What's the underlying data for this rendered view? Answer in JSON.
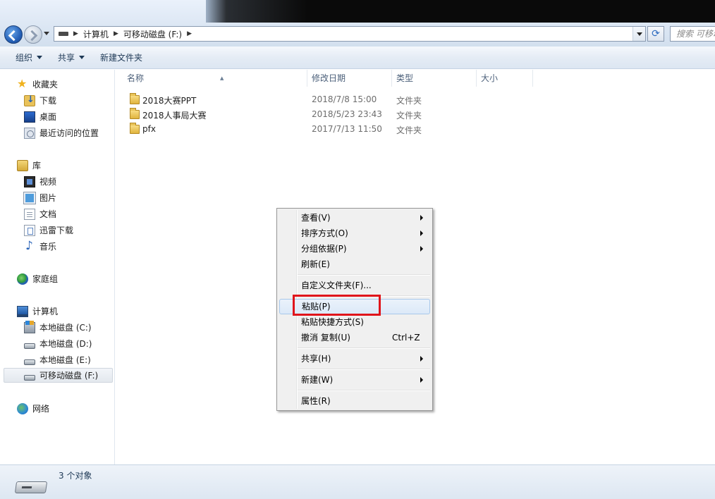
{
  "address": {
    "crumbs": [
      "计算机",
      "可移动磁盘 (F:)"
    ],
    "search_placeholder": "搜索 可移动"
  },
  "toolbar": {
    "organize": "组织",
    "share": "共享",
    "new_folder": "新建文件夹"
  },
  "sidebar": {
    "favorites": "收藏夹",
    "downloads": "下载",
    "desktop": "桌面",
    "recent": "最近访问的位置",
    "libraries": "库",
    "videos": "视频",
    "pictures": "图片",
    "documents": "文档",
    "thunder": "迅雷下载",
    "music": "音乐",
    "homegroup": "家庭组",
    "computer": "计算机",
    "drive_c": "本地磁盘 (C:)",
    "drive_d": "本地磁盘 (D:)",
    "drive_e": "本地磁盘 (E:)",
    "drive_f": "可移动磁盘 (F:)",
    "network": "网络"
  },
  "columns": {
    "name": "名称",
    "date": "修改日期",
    "type": "类型",
    "size": "大小"
  },
  "files": [
    {
      "name": "2018大赛PPT",
      "date": "2018/7/8 15:00",
      "type": "文件夹"
    },
    {
      "name": "2018人事局大赛",
      "date": "2018/5/23 23:43",
      "type": "文件夹"
    },
    {
      "name": "pfx",
      "date": "2017/7/13 11:50",
      "type": "文件夹"
    }
  ],
  "status": {
    "count": "3 个对象"
  },
  "context_menu": {
    "view": "查看(V)",
    "sort": "排序方式(O)",
    "group": "分组依据(P)",
    "refresh": "刷新(E)",
    "customize": "自定义文件夹(F)...",
    "paste": "粘贴(P)",
    "paste_shortcut": "粘贴快捷方式(S)",
    "undo": "撤消 复制(U)",
    "undo_shortcut": "Ctrl+Z",
    "share": "共享(H)",
    "new": "新建(W)",
    "properties": "属性(R)"
  },
  "colors": {
    "highlight_box": "#e0151b",
    "menu_hover": "#dce9f8"
  }
}
